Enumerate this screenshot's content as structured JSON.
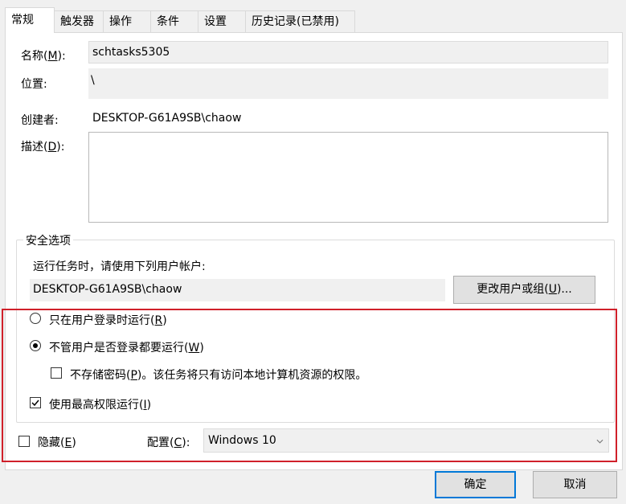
{
  "tabs": [
    "常规",
    "触发器",
    "操作",
    "条件",
    "设置",
    "历史记录(已禁用)"
  ],
  "name_label": "名称",
  "name_key": "M",
  "name_value": "schtasks5305",
  "location_label": "位置:",
  "location_value": "\\",
  "author_label": "创建者:",
  "author_value": "DESKTOP-G61A9SB\\chaow",
  "desc_label": "描述",
  "desc_key": "D",
  "desc_value": "",
  "security": {
    "title": "安全选项",
    "account_prompt": "运行任务时，请使用下列用户帐户:",
    "account_value": "DESKTOP-G61A9SB\\chaow",
    "change_btn_label": "更改用户或组",
    "change_btn_key": "U",
    "change_btn_suffix": "...",
    "radio_logged_on_label": "只在用户登录时运行",
    "radio_logged_on_key": "R",
    "radio_logged_on_selected": false,
    "radio_whether_label": "不管用户是否登录都要运行",
    "radio_whether_key": "W",
    "radio_whether_selected": true,
    "no_store_pwd_label": "不存储密码",
    "no_store_pwd_key": "P",
    "no_store_pwd_suffix": "。该任务将只有访问本地计算机资源的权限。",
    "no_store_pwd_checked": false,
    "highest_label": "使用最高权限运行",
    "highest_key": "I",
    "highest_checked": true
  },
  "hidden_label": "隐藏",
  "hidden_key": "E",
  "hidden_checked": false,
  "config_label": "配置",
  "config_key": "C",
  "config_value": "Windows 10",
  "ok_label": "确定",
  "cancel_label": "取消",
  "colors": {
    "highlight_border": "#d0202a",
    "default_button_border": "#0078d7"
  }
}
